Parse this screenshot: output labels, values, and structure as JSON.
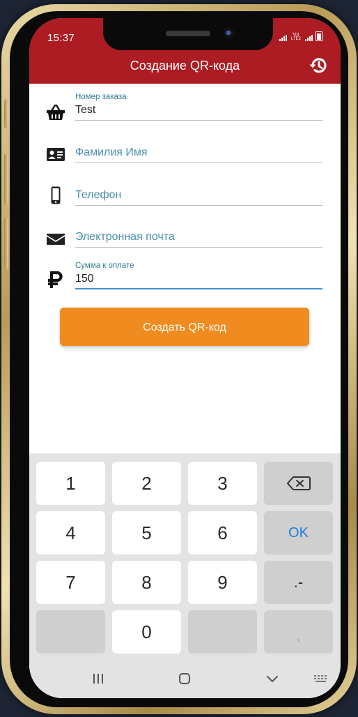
{
  "status_bar": {
    "time": "15:37",
    "network_label": "Vo) LTE2"
  },
  "app_bar": {
    "title": "Создание QR-кода",
    "history_icon": "history-icon"
  },
  "form": {
    "order_number": {
      "label": "Номер заказа",
      "value": "Test",
      "icon": "basket-icon"
    },
    "full_name": {
      "placeholder": "Фамилия Имя",
      "icon": "id-card-icon"
    },
    "phone": {
      "placeholder": "Телефон",
      "icon": "smartphone-icon"
    },
    "email": {
      "placeholder": "Электронная почта",
      "icon": "envelope-icon"
    },
    "amount": {
      "label": "Сумма к оплате",
      "value": "150",
      "icon": "ruble-icon"
    }
  },
  "create_button_label": "Создать QR-код",
  "keyboard": {
    "keys": {
      "k1": "1",
      "k2": "2",
      "k3": "3",
      "k4": "4",
      "k5": "5",
      "k6": "6",
      "k7": "7",
      "k8": "8",
      "k9": "9",
      "k0": "0",
      "ok": "OK",
      "dot_minus": ".-",
      "comma": ","
    },
    "backspace_icon": "backspace-icon"
  },
  "colors": {
    "header": "#ad1b23",
    "accent": "#f08b1f",
    "input_focus": "#4a90c8",
    "ok_key": "#1f7bd8"
  }
}
